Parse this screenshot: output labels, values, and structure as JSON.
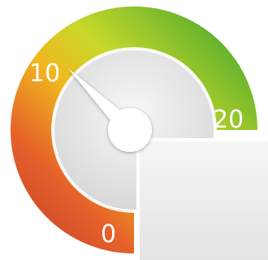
{
  "gauge": {
    "min": 0,
    "mid": 10,
    "max": 20,
    "value": 10,
    "labels": {
      "min": "0",
      "mid": "10",
      "max": "20"
    },
    "colors": {
      "low": "#c0392b",
      "low_mid": "#e67e22",
      "mid": "#f1c40f",
      "high_mid": "#a8d52a",
      "high": "#3aa635",
      "face": "#e6e6e6",
      "needle": "#ffffff",
      "panel": "#f0f0f0"
    }
  }
}
